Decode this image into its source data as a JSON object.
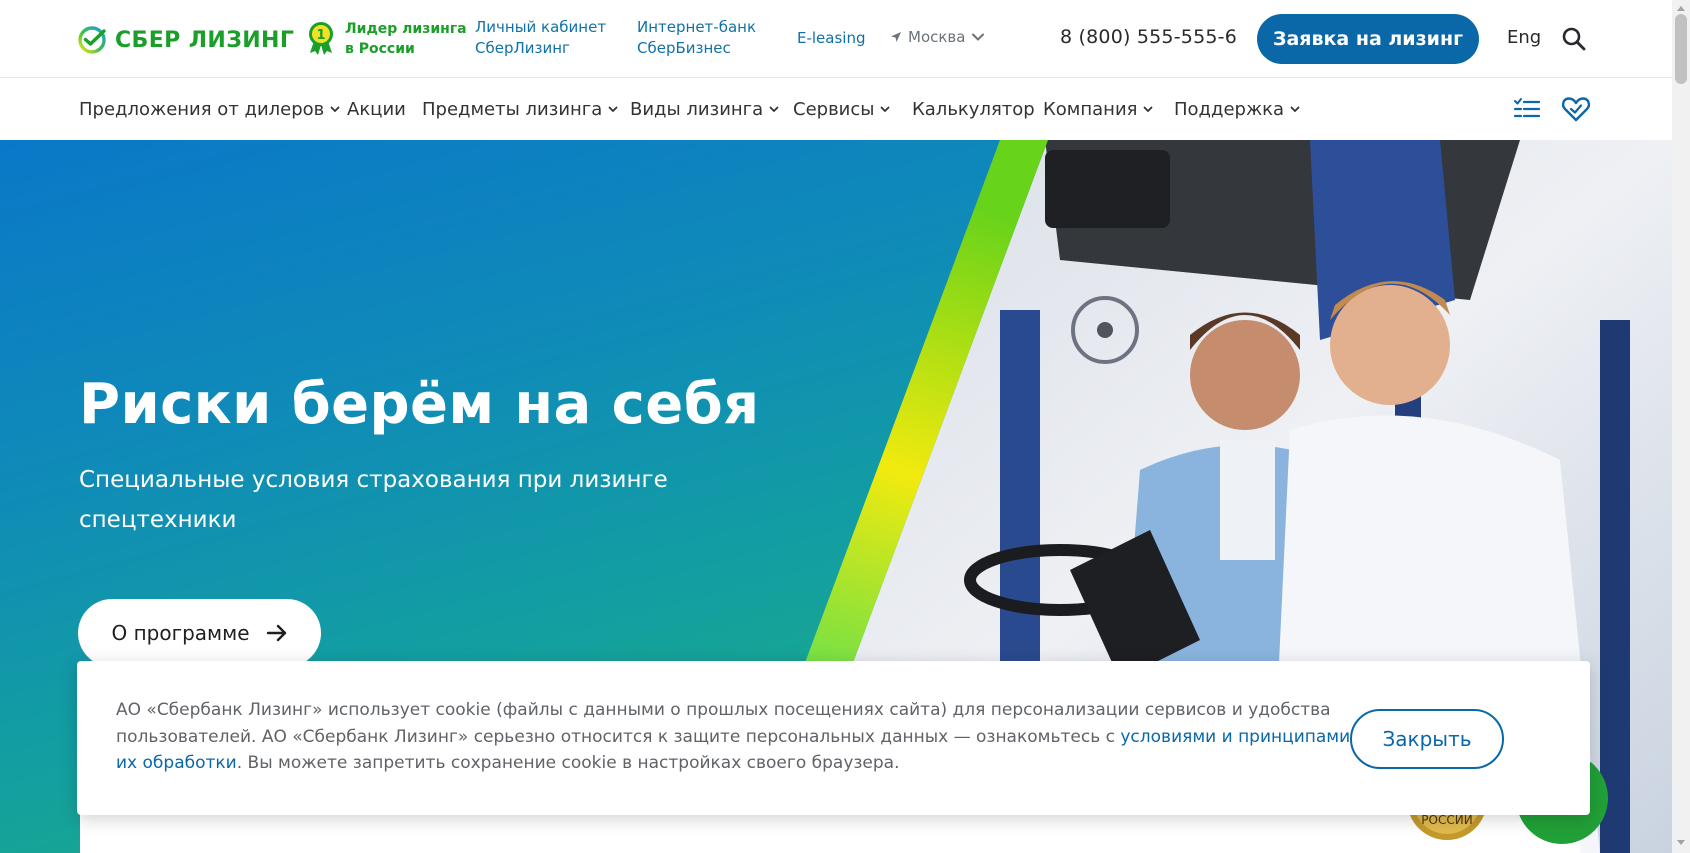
{
  "header": {
    "logo_text": "СБЕР ЛИЗИНГ",
    "leader": {
      "line1": "Лидер лизинга",
      "line2": "в России",
      "badge_number": "1"
    },
    "links": [
      {
        "line1": "Личный кабинет",
        "line2": "СберЛизинг"
      },
      {
        "line1": "Интернет-банк",
        "line2": "СберБизнес"
      }
    ],
    "eleasing": "E-leasing",
    "city": "Москва",
    "phone": "8 (800) 555-555-6",
    "cta_label": "Заявка на лизинг",
    "lang": "Eng"
  },
  "nav": {
    "items": [
      {
        "label": "Предложения от дилеров",
        "has_dropdown": true
      },
      {
        "label": "Акции",
        "has_dropdown": false
      },
      {
        "label": "Предметы лизинга",
        "has_dropdown": true
      },
      {
        "label": "Виды лизинга",
        "has_dropdown": true
      },
      {
        "label": "Сервисы",
        "has_dropdown": true
      },
      {
        "label": "Калькулятор",
        "has_dropdown": false
      },
      {
        "label": "Компания",
        "has_dropdown": true
      },
      {
        "label": "Поддержка",
        "has_dropdown": true
      }
    ],
    "icons": [
      "compare-list-icon",
      "favorites-heart-icon"
    ]
  },
  "hero": {
    "title": "Риски берём на себя",
    "subtitle": "Специальные условия страхования при лизинге спецтехники",
    "button_label": "О программе"
  },
  "medal_text": "РОССИИ",
  "cookie": {
    "text_before": "АО «Сбербанк Лизинг» использует cookie (файлы с данными о прошлых посещениях сайта) для персонализации сервисов и удобства пользователей. АО «Сбербанк Лизинг» серьезно относится к защите персональных данных — ознакомьтесь с ",
    "link_text": "условиями и принципами их обработки",
    "text_after": ". Вы можете запретить сохранение cookie в настройках своего браузера.",
    "close_label": "Закрыть"
  },
  "colors": {
    "brand_green": "#1a9f29",
    "link_blue": "#1071a8",
    "cta_blue": "#0a67a8",
    "hero_gradient_start": "#0a78c8",
    "hero_gradient_end": "#28b877"
  }
}
